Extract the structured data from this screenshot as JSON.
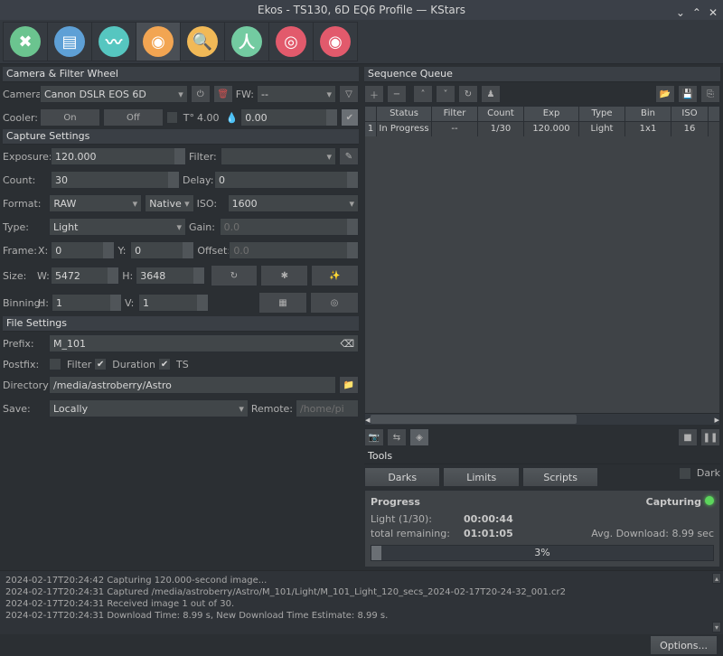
{
  "title": "Ekos - TS130, 6D EQ6 Profile — KStars",
  "camera_filter": {
    "section": "Camera & Filter Wheel",
    "camera_label": "Camera",
    "camera_value": "Canon DSLR EOS 6D",
    "fw_label": "FW:",
    "fw_value": "--",
    "cooler_label": "Cooler:",
    "cooler_on": "On",
    "cooler_off": "Off",
    "temp_label": "T°",
    "temp_value": "4.00",
    "humidity_value": "0.00"
  },
  "capture": {
    "section": "Capture Settings",
    "exposure_label": "Exposure:",
    "exposure_value": "120.000",
    "filter_label": "Filter:",
    "filter_value": "",
    "count_label": "Count:",
    "count_value": "30",
    "delay_label": "Delay:",
    "delay_value": "0",
    "format_label": "Format:",
    "format_value": "RAW",
    "native_value": "Native",
    "iso_label": "ISO:",
    "iso_value": "1600",
    "type_label": "Type:",
    "type_value": "Light",
    "gain_label": "Gain:",
    "gain_value": "0.0",
    "frame_label": "Frame:",
    "frame_x_label": "X:",
    "frame_x": "0",
    "frame_y_label": "Y:",
    "frame_y": "0",
    "offset_label": "Offset:",
    "offset_value": "0.0",
    "size_label": "Size:",
    "size_w_label": "W:",
    "size_w": "5472",
    "size_h_label": "H:",
    "size_h": "3648",
    "binning_label": "Binning:",
    "bin_h_label": "H:",
    "bin_h": "1",
    "bin_v_label": "V:",
    "bin_v": "1"
  },
  "file": {
    "section": "File Settings",
    "prefix_label": "Prefix:",
    "prefix_value": "M_101",
    "postfix_label": "Postfix:",
    "postfix_filter": "Filter",
    "postfix_duration": "Duration",
    "postfix_ts": "TS",
    "dir_label": "Directory:",
    "dir_value": "/media/astroberry/Astro",
    "save_label": "Save:",
    "save_value": "Locally",
    "remote_label": "Remote:",
    "remote_value": "/home/pi"
  },
  "queue": {
    "section": "Sequence Queue",
    "headers": {
      "status": "Status",
      "filter": "Filter",
      "count": "Count",
      "exp": "Exp",
      "type": "Type",
      "bin": "Bin",
      "iso": "ISO"
    },
    "rows": [
      {
        "n": "1",
        "status": "In Progress",
        "filter": "--",
        "count": "1/30",
        "exp": "120.000",
        "type": "Light",
        "bin": "1x1",
        "iso": "16"
      }
    ]
  },
  "tools": {
    "label": "Tools",
    "darks": "Darks",
    "limits": "Limits",
    "scripts": "Scripts",
    "dark_chk": "Dark"
  },
  "progress": {
    "title": "Progress",
    "status": "Capturing",
    "light_label": "Light  (1/30):",
    "light_time": "00:00:44",
    "total_label": "total remaining:",
    "total_time": "01:01:05",
    "avg": "Avg. Download: 8.99 sec",
    "pct_text": "3%",
    "pct": 3
  },
  "log": [
    "2024-02-17T20:24:42 Capturing 120.000-second  image...",
    "2024-02-17T20:24:31 Captured /media/astroberry/Astro/M_101/Light/M_101_Light_120_secs_2024-02-17T20-24-32_001.cr2",
    "2024-02-17T20:24:31 Received image 1 out of 30.",
    "2024-02-17T20:24:31 Download Time: 8.99 s, New Download Time Estimate: 8.99 s."
  ],
  "footer": {
    "options": "Options..."
  }
}
